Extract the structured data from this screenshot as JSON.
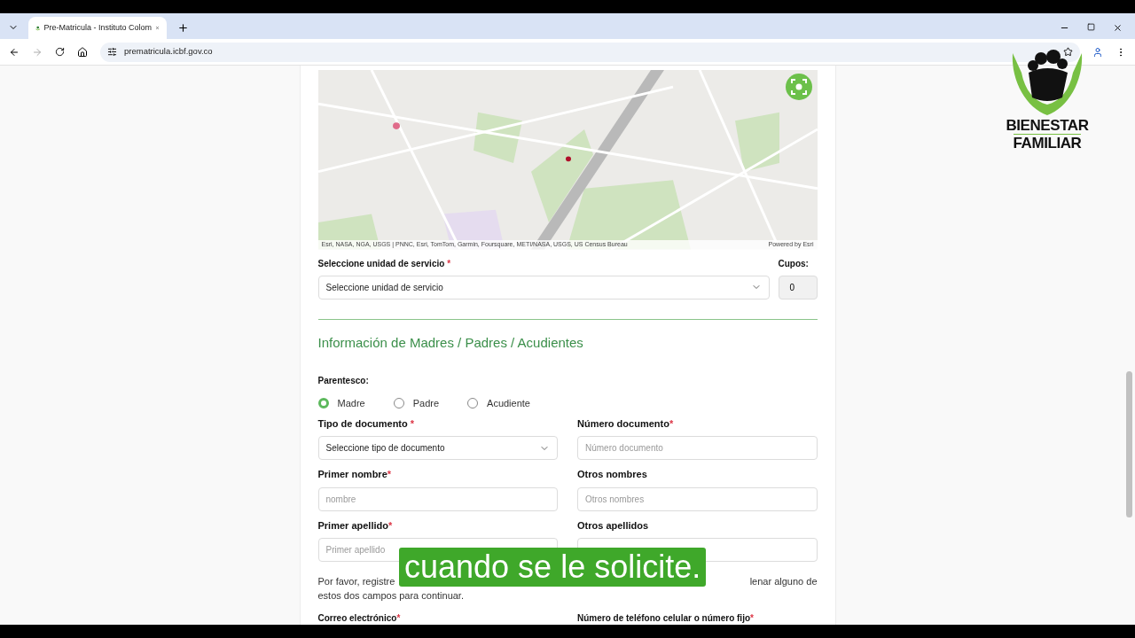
{
  "browser": {
    "tab_title": "Pre-Matricula - Instituto Colom",
    "url": "prematricula.icbf.gov.co"
  },
  "logo": {
    "line1": "BIENESTAR",
    "line2": "FAMILIAR"
  },
  "map": {
    "kind": "picture",
    "attribution": "Esri, NASA, NGA, USGS | PNNC, Esri, TomTom, Garmin, Foursquare, METI/NASA, USGS, US Census Bureau",
    "powered_by": "Powered by Esri"
  },
  "service_unit": {
    "label": "Seleccione unidad de servicio",
    "required_mark": "*",
    "value": "Seleccione unidad de servicio"
  },
  "cupos": {
    "label": "Cupos:",
    "value": "0"
  },
  "section_title": "Información de Madres / Padres / Acudientes",
  "parentesco": {
    "label": "Parentesco:",
    "options": [
      {
        "label": "Madre",
        "selected": true
      },
      {
        "label": "Padre",
        "selected": false
      },
      {
        "label": "Acudiente",
        "selected": false
      }
    ]
  },
  "fields": [
    {
      "kind": "select",
      "label": "Tipo de documento",
      "required_mark": " *",
      "value": "Seleccione tipo de documento"
    },
    {
      "kind": "input",
      "label": "Número documento",
      "required_mark": "*",
      "placeholder": "Número documento"
    },
    {
      "kind": "input",
      "label": "Primer nombre",
      "required_mark": "*",
      "placeholder": "nombre"
    },
    {
      "kind": "input",
      "label": "Otros nombres",
      "placeholder": "Otros nombres"
    },
    {
      "kind": "input",
      "label": "Primer apellido",
      "required_mark": "*",
      "placeholder": "Primer apellido"
    },
    {
      "kind": "input",
      "label": "Otros apellidos"
    }
  ],
  "notice": {
    "line1_start": "Por favor, registre",
    "line1_end": "lenar alguno de",
    "line2": "estos dos campos para continuar."
  },
  "bottom_labels": [
    {
      "label": "Correo electrónico",
      "required_mark": "*"
    },
    {
      "label": "Número de teléfono celular o número fijo",
      "required_mark": "*"
    }
  ],
  "caption": "cuando se le solicite."
}
